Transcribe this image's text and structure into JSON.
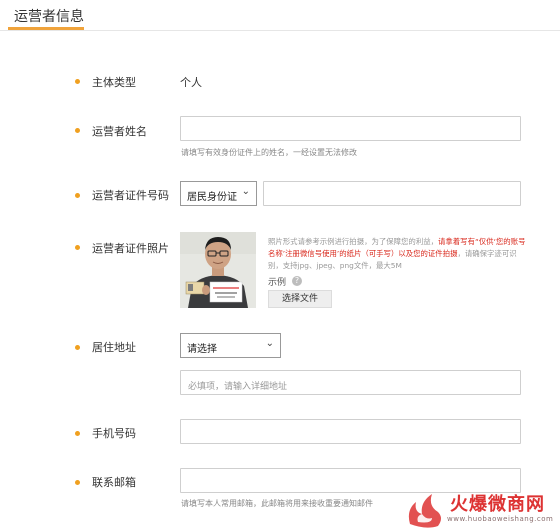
{
  "tab": {
    "title": "运营者信息"
  },
  "form": {
    "entity_type": {
      "label": "主体类型",
      "value": "个人"
    },
    "operator_name": {
      "label": "运营者姓名",
      "value": "",
      "hint": "请填写有效身份证件上的姓名，一经设置无法修改"
    },
    "id_number": {
      "label": "运营者证件号码",
      "id_type": "居民身份证",
      "value": ""
    },
    "id_photo": {
      "label": "运营者证件照片",
      "note_parts": [
        "照片形式请参考示例进行拍摄，为了保障您的利益，",
        "请拿着写有“仅供‘您的账号名称’注册微信号使用’的纸片（可手写）以及您的证件拍摄",
        "，请确保字迹可识别，支持jpg、jpeg、png文件，最大5M"
      ],
      "example_label": "示例",
      "button_label": "选择文件",
      "photo_caption": "仅供“您的账号名称”注册微信号使用"
    },
    "address": {
      "label": "居住地址",
      "select_value": "请选择",
      "placeholder": "必填项，请输入详细地址"
    },
    "phone": {
      "label": "手机号码",
      "value": ""
    },
    "email": {
      "label": "联系邮箱",
      "value": "",
      "hint": "请填写本人常用邮箱，此邮箱将用来接收重要通知邮件"
    }
  },
  "watermark": {
    "text": "火爆微商网",
    "sub": "www.huobaoweishang.com"
  },
  "colors": {
    "accent": "#f0a33b",
    "dot": "#f0a020",
    "warning": "#d9281c"
  }
}
